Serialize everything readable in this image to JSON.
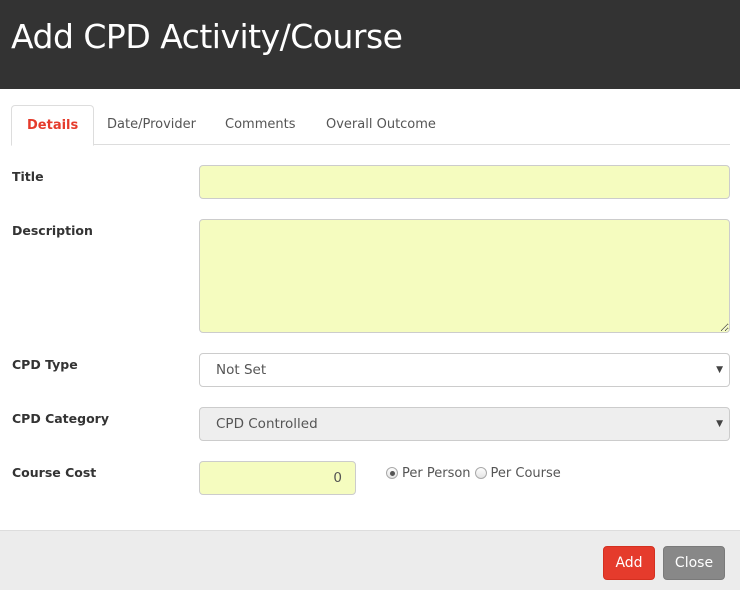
{
  "dialog": {
    "title": "Add CPD Activity/Course"
  },
  "tabs": [
    {
      "label": "Details",
      "active": true
    },
    {
      "label": "Date/Provider",
      "active": false
    },
    {
      "label": "Comments",
      "active": false
    },
    {
      "label": "Overall Outcome",
      "active": false
    }
  ],
  "form": {
    "title": {
      "label": "Title",
      "value": ""
    },
    "description": {
      "label": "Description",
      "value": ""
    },
    "cpd_type": {
      "label": "CPD Type",
      "selected": "Not Set"
    },
    "cpd_category": {
      "label": "CPD Category",
      "selected": "CPD Controlled",
      "disabled": true
    },
    "course_cost": {
      "label": "Course Cost",
      "value": "0",
      "options": [
        {
          "label": "Per Person",
          "checked": true
        },
        {
          "label": "Per Course",
          "checked": false
        }
      ]
    }
  },
  "icons": {
    "dropdown": "▼"
  },
  "footer": {
    "add_label": "Add",
    "close_label": "Close"
  },
  "colors": {
    "header_bg": "#333333",
    "accent": "#e53b2c",
    "input_highlight": "#f5fcbf",
    "close_button": "#888888",
    "footer_bg": "#ececec"
  }
}
